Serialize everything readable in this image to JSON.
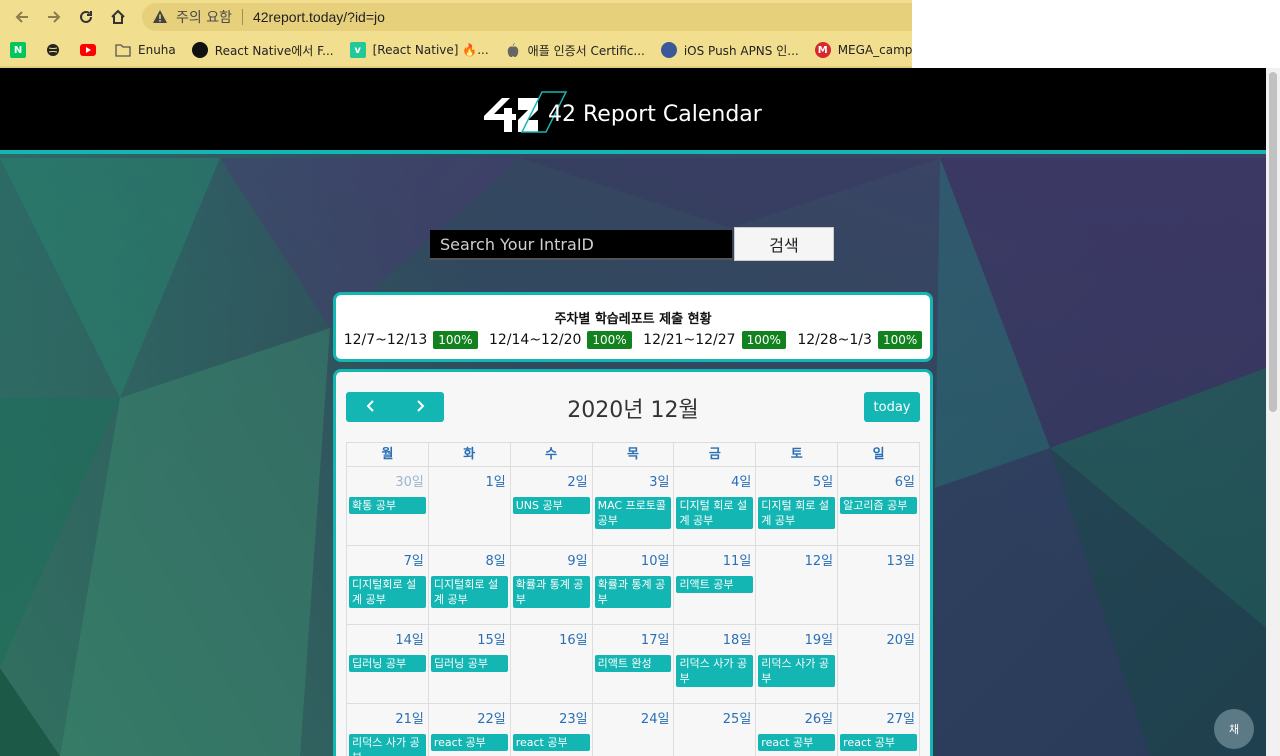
{
  "browser": {
    "warning_text": "주의 요함",
    "url": "42report.today/?id=jo",
    "bookmarks": [
      {
        "label": "",
        "icon": "naver-icon",
        "color": "#03c75a"
      },
      {
        "label": "",
        "icon": "globe-icon",
        "color": "#222222"
      },
      {
        "label": "",
        "icon": "youtube-icon",
        "color": "#ff0000"
      },
      {
        "label": "Enuha",
        "icon": "folder-icon",
        "color": "#5a5a5a"
      },
      {
        "label": "React Native에서 F...",
        "icon": "react-icon",
        "color": "#111111"
      },
      {
        "label": "[React Native] 🔥...",
        "icon": "velog-icon",
        "color": "#20c997"
      },
      {
        "label": "애플 인증서 Certific...",
        "icon": "apple-icon",
        "color": "#555555"
      },
      {
        "label": "iOS Push APNS 인...",
        "icon": "avatar-icon",
        "color": "#3b5998"
      },
      {
        "label": "MEGA_campustax",
        "icon": "mega-icon",
        "color": "#d9272e"
      }
    ]
  },
  "site": {
    "title": "42 Report Calendar"
  },
  "search": {
    "placeholder": "Search Your IntraID",
    "button_label": "검색"
  },
  "weekly": {
    "title": "주차별 학습레포트 제출 현황",
    "weeks": [
      {
        "range": "12/7~12/13",
        "percent": "100%"
      },
      {
        "range": "12/14~12/20",
        "percent": "100%"
      },
      {
        "range": "12/21~12/27",
        "percent": "100%"
      },
      {
        "range": "12/28~1/3",
        "percent": "100%"
      }
    ]
  },
  "calendar": {
    "title": "2020년 12월",
    "prev_label": "‹",
    "next_label": "›",
    "today_label": "today",
    "weekdays": [
      "월",
      "화",
      "수",
      "목",
      "금",
      "토",
      "일"
    ],
    "weeks": [
      [
        {
          "day": "30일",
          "other": true,
          "event": "확통 공부"
        },
        {
          "day": "1일",
          "event": ""
        },
        {
          "day": "2일",
          "event": "UNS 공부"
        },
        {
          "day": "3일",
          "event": "MAC 프로토콜 공부"
        },
        {
          "day": "4일",
          "event": "디지털 회로 설계 공부"
        },
        {
          "day": "5일",
          "event": "디지털 회로 설계 공부"
        },
        {
          "day": "6일",
          "event": "알고리즘 공부"
        }
      ],
      [
        {
          "day": "7일",
          "event": "디지털회로 설계 공부"
        },
        {
          "day": "8일",
          "event": "디지털회로 설계 공부"
        },
        {
          "day": "9일",
          "event": "확률과 통계 공부"
        },
        {
          "day": "10일",
          "event": "확률과 통계 공부"
        },
        {
          "day": "11일",
          "event": "리액트 공부"
        },
        {
          "day": "12일",
          "event": ""
        },
        {
          "day": "13일",
          "event": ""
        }
      ],
      [
        {
          "day": "14일",
          "event": "딥러닝 공부"
        },
        {
          "day": "15일",
          "event": "딥러닝 공부"
        },
        {
          "day": "16일",
          "event": ""
        },
        {
          "day": "17일",
          "event": "리액트 완성"
        },
        {
          "day": "18일",
          "event": "리덕스 사가 공부"
        },
        {
          "day": "19일",
          "event": "리덕스 사가 공부"
        },
        {
          "day": "20일",
          "event": ""
        }
      ],
      [
        {
          "day": "21일",
          "event": "리덕스 사가 공부"
        },
        {
          "day": "22일",
          "event": "react 공부"
        },
        {
          "day": "23일",
          "event": "react 공부"
        },
        {
          "day": "24일",
          "event": ""
        },
        {
          "day": "25일",
          "event": ""
        },
        {
          "day": "26일",
          "event": "react 공부"
        },
        {
          "day": "27일",
          "event": "react 공부"
        }
      ]
    ]
  },
  "chat": {
    "label": "채"
  }
}
